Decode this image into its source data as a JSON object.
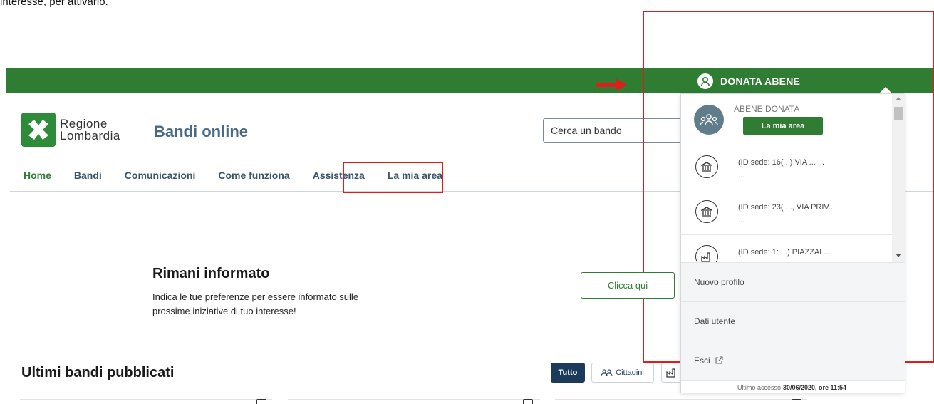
{
  "intro_text": "interesse, per attivarlo.",
  "user": {
    "name": "DONATA ABENE"
  },
  "header": {
    "logo_line1": "Regione",
    "logo_line2": "Lombardia",
    "app_title": "Bandi online",
    "search_placeholder": "Cerca un bando"
  },
  "nav": {
    "items": [
      {
        "label": "Home",
        "active": true
      },
      {
        "label": "Bandi"
      },
      {
        "label": "Comunicazioni"
      },
      {
        "label": "Come funziona"
      },
      {
        "label": "Assistenza"
      },
      {
        "label": "La mia area"
      }
    ]
  },
  "inform": {
    "title": "Rimani informato",
    "description": "Indica le tue preferenze per essere informato sulle prossime iniziative di tuo interesse!",
    "button_label": "Clicca qui"
  },
  "latest": {
    "title": "Ultimi bandi pubblicati",
    "filters": [
      "Tutto",
      "Cittadini"
    ]
  },
  "dropdown": {
    "profile_name": "ABENE DONATA",
    "area_button": "La mia area",
    "sites": [
      {
        "text": "(ID sede: 16( . ) VIA ... ...",
        "sub": "...",
        "icon": "bank-icon"
      },
      {
        "text": "(ID sede: 23( ..., VIA PRIV...",
        "sub": "...",
        "icon": "bank-icon"
      },
      {
        "text": "(ID sede: 1: ...) PIAZZAL...",
        "sub": "",
        "icon": "factory-icon"
      }
    ],
    "menu": [
      "Nuovo profilo",
      "Dati utente",
      "Esci"
    ],
    "last_access_label": "Ultimo accesso",
    "last_access_value": "30/06/2020, ore 11:54"
  },
  "colors": {
    "brand_green": "#2e7d32",
    "nav_blue": "#38556b",
    "highlight_red": "#e31b1b"
  }
}
